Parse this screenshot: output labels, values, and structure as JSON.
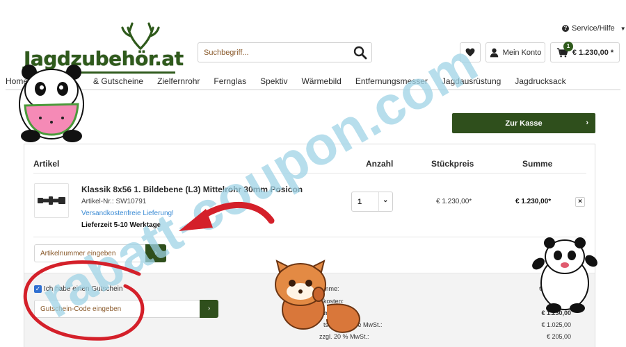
{
  "brand": {
    "logo_text": "Jagdzubehör",
    "logo_tld": ".at",
    "color": "#2f5a1c"
  },
  "search": {
    "placeholder": "Suchbegriff..."
  },
  "service": {
    "label": "Service/Hilfe"
  },
  "header": {
    "account_label": "Mein Konto",
    "cart_count": "1",
    "cart_total": "€ 1.230,00 *"
  },
  "nav": {
    "items": [
      "Home",
      "& Gutscheine",
      "Zielfernrohr",
      "Fernglas",
      "Spektiv",
      "Wärmebild",
      "Entfernungsmesser",
      "Jagdausrüstung",
      "Jagdrucksack"
    ]
  },
  "checkout": {
    "label": "Zur Kasse"
  },
  "cart": {
    "headers": {
      "article": "Artikel",
      "quantity": "Anzahl",
      "unit_price": "Stückpreis",
      "total": "Summe"
    },
    "item": {
      "name": "Klassik 8x56 1. Bildebene (L3) Mittelrohr 30mm Posicon",
      "number": "Artikel-Nr.: SW10791",
      "shipping": "Versandkostenfreie Lieferung!",
      "delivery": "Lieferzeit 5-10 Werktage",
      "quantity": "1",
      "unit_price": "€ 1.230,00*",
      "total": "€ 1.230,00*",
      "remove": "×"
    },
    "article_input_placeholder": "Artikelnummer eingeben",
    "voucher_checkbox_label": "Ich habe einen Gutschein",
    "voucher_placeholder": "Gutschein-Code eingeben"
  },
  "summary": {
    "rows": [
      {
        "label": "mme:",
        "value": "€ 1.2"
      },
      {
        "label": "kosten:",
        "value": "€"
      },
      {
        "label": "mme:",
        "value": "€ 1.230,00"
      },
      {
        "label": "tsumme ohne MwSt.:",
        "value": "€ 1.025,00"
      },
      {
        "label": "zzgl. 20 % MwSt.:",
        "value": "€ 205,00"
      }
    ]
  },
  "watermark": {
    "text": "rabatt-coupon.com",
    "color": "#9fd3e6"
  },
  "colors": {
    "accent": "#2f4f1c",
    "link": "#3b8bd4",
    "arrow": "#d4202a"
  }
}
